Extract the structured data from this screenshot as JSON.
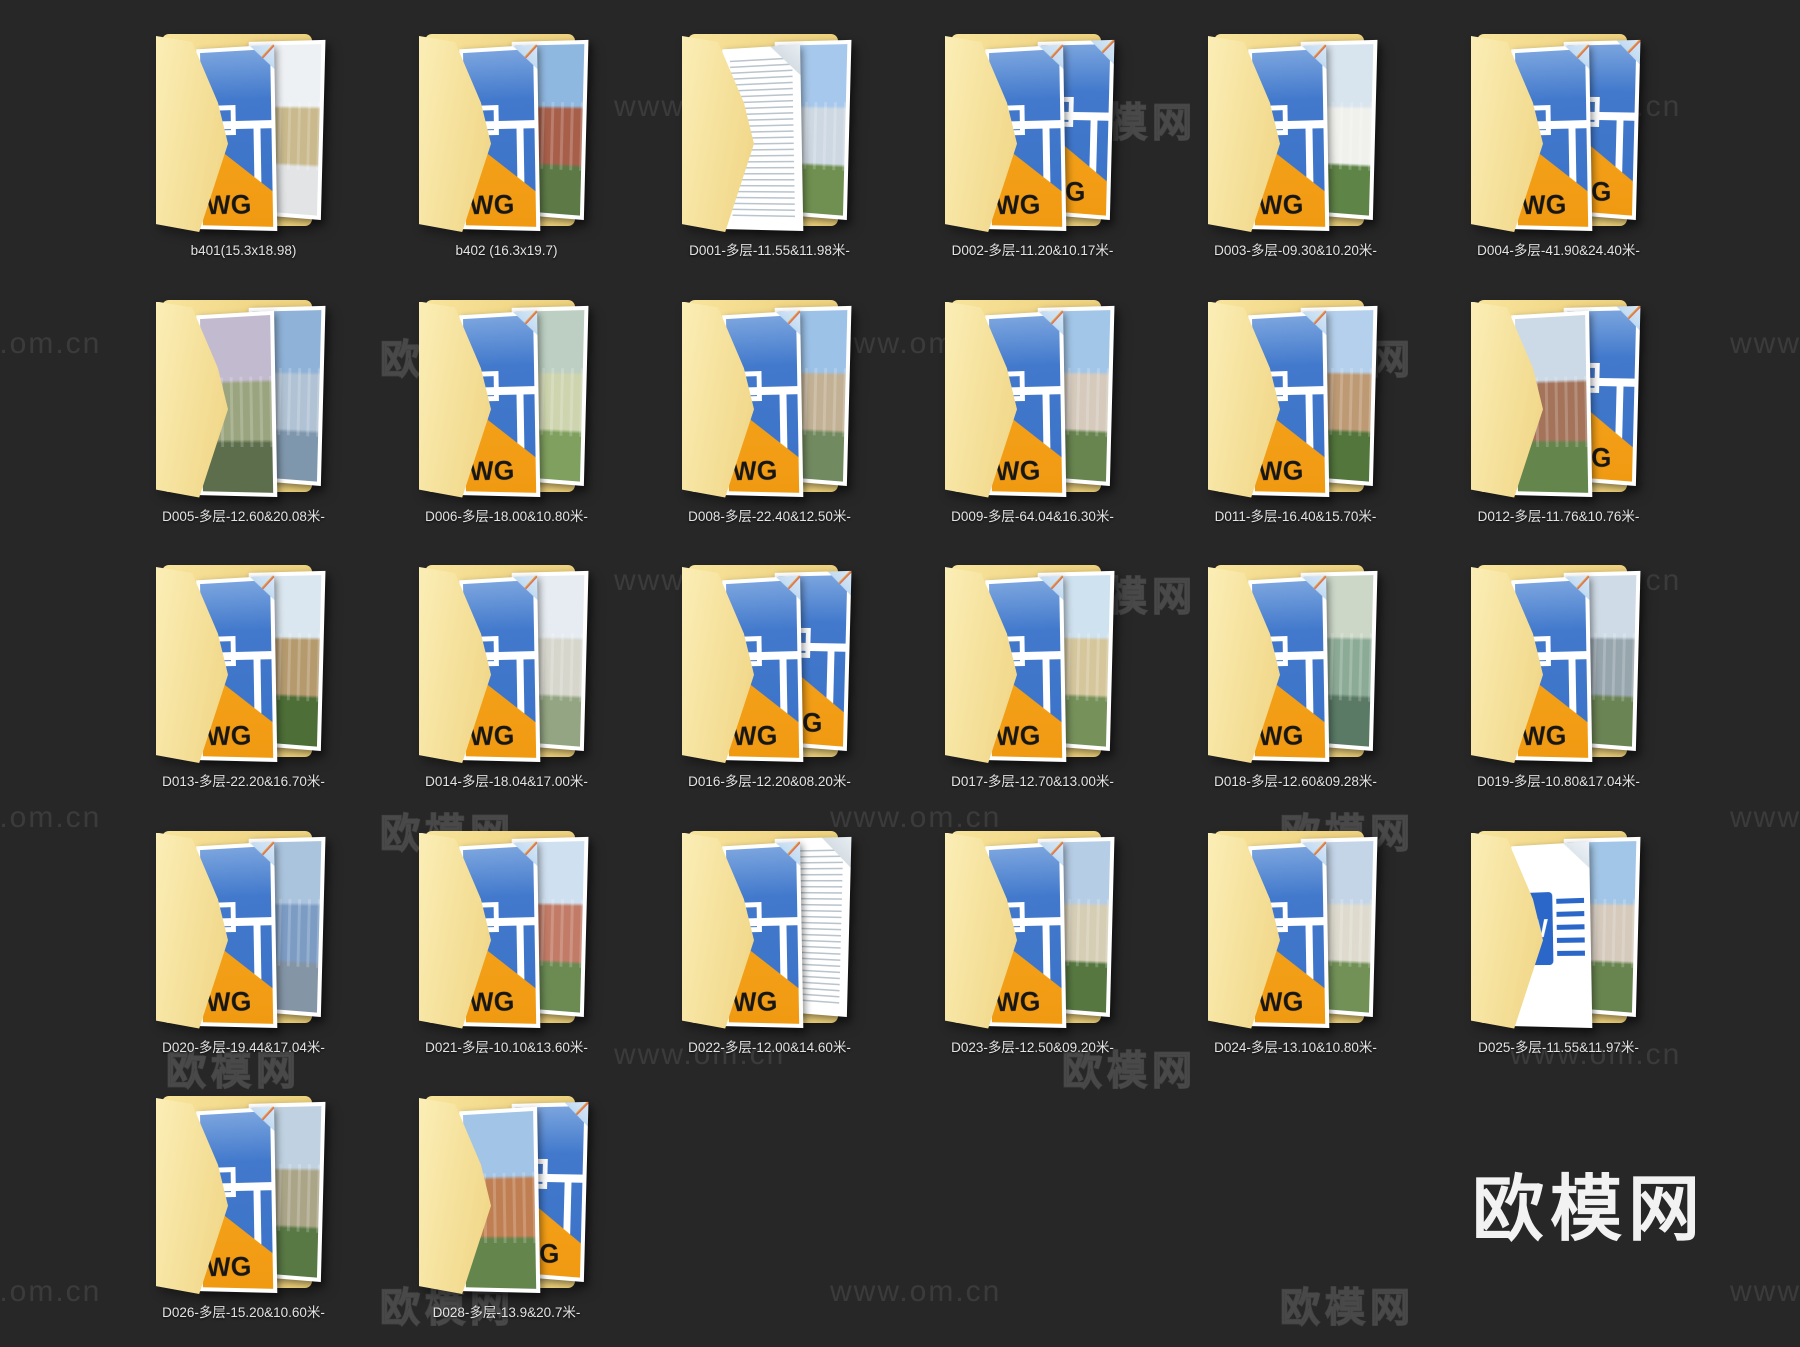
{
  "page": {
    "background": "#272727"
  },
  "watermark": {
    "logo_text": "欧模网",
    "url_text": "www.om.cn"
  },
  "footer_logo": {
    "text": "欧模网"
  },
  "file_type_labels": {
    "dwg_text": "WG",
    "word_letter": "W"
  },
  "accent_colors": {
    "folder_yellow": "#f0d584",
    "dwg_blue": "#3a72c8",
    "dwg_orange": "#f8a81f",
    "word_blue": "#2b67c8",
    "label_text": "#e4e4e4"
  },
  "items": [
    {
      "name": "b401",
      "label": "b401(15.3x18.98)",
      "front": "dwg",
      "back": "photo",
      "back_thumb": {
        "sky": "#eef1f4",
        "mid": "#c9b98c",
        "base": "#e2e4e6"
      }
    },
    {
      "name": "b402",
      "label": "b402 (16.3x19.7)",
      "front": "dwg",
      "back": "photo",
      "back_thumb": {
        "sky": "#8fb8e0",
        "mid": "#a85f4a",
        "base": "#5d7a46"
      }
    },
    {
      "name": "D001",
      "label": "D001-多层-11.55&11.98米-",
      "front": "doc",
      "back": "photo",
      "back_thumb": {
        "sky": "#a6c8ec",
        "mid": "#cdd8e2",
        "base": "#6f9050"
      }
    },
    {
      "name": "D002",
      "label": "D002-多层-11.20&10.17米-",
      "front": "dwg",
      "back": "dwg"
    },
    {
      "name": "D003",
      "label": "D003-多层-09.30&10.20米-",
      "front": "dwg",
      "back": "photo",
      "back_thumb": {
        "sky": "#d8e4ee",
        "mid": "#f0f0ec",
        "base": "#5f8447"
      }
    },
    {
      "name": "D004",
      "label": "D004-多层-41.90&24.40米-",
      "front": "dwg",
      "back": "dwg"
    },
    {
      "name": "D005",
      "label": "D005-多层-12.60&20.08米-",
      "front": "photo",
      "back": "photo",
      "front_thumb": {
        "sky": "#c2bacf",
        "mid": "#9aa47e",
        "base": "#5c6e4c"
      },
      "back_thumb": {
        "sky": "#8fb2d8",
        "mid": "#b0c2d4",
        "base": "#7f97ad"
      }
    },
    {
      "name": "D006",
      "label": "D006-多层-18.00&10.80米-",
      "front": "dwg",
      "back": "photo",
      "back_thumb": {
        "sky": "#bccfc2",
        "mid": "#cdd4ae",
        "base": "#7fa05e"
      }
    },
    {
      "name": "D008",
      "label": "D008-多层-22.40&12.50米-",
      "front": "dwg",
      "back": "photo",
      "back_thumb": {
        "sky": "#9cc2e8",
        "mid": "#c2b194",
        "base": "#728a60"
      }
    },
    {
      "name": "D009",
      "label": "D009-多层-64.04&16.30米-",
      "front": "dwg",
      "back": "photo",
      "back_thumb": {
        "sky": "#a2c6e8",
        "mid": "#d5cabc",
        "base": "#68854f"
      }
    },
    {
      "name": "D011",
      "label": "D011-多层-16.40&15.70米-",
      "front": "dwg",
      "back": "photo",
      "back_thumb": {
        "sky": "#b4d0ec",
        "mid": "#bd9a74",
        "base": "#53763c"
      }
    },
    {
      "name": "D012",
      "label": "D012-多层-11.76&10.76米-",
      "front": "photo",
      "back": "dwg",
      "front_thumb": {
        "sky": "#ccd9e6",
        "mid": "#a4735a",
        "base": "#64854c"
      }
    },
    {
      "name": "D013",
      "label": "D013-多层-22.20&16.70米-",
      "front": "dwg",
      "back": "photo",
      "back_thumb": {
        "sky": "#dbe7f0",
        "mid": "#b59a6e",
        "base": "#4d6e36"
      }
    },
    {
      "name": "D014",
      "label": "D014-多层-18.04&17.00米-",
      "front": "dwg",
      "back": "photo",
      "back_thumb": {
        "sky": "#e6ecf2",
        "mid": "#d6d6cc",
        "base": "#93a582"
      }
    },
    {
      "name": "D016",
      "label": "D016-多层-12.20&08.20米-",
      "front": "dwg",
      "back": "dwg"
    },
    {
      "name": "D017",
      "label": "D017-多层-12.70&13.00米-",
      "front": "dwg",
      "back": "photo",
      "back_thumb": {
        "sky": "#cfe2f0",
        "mid": "#d5c69c",
        "base": "#76915a"
      }
    },
    {
      "name": "D018",
      "label": "D018-多层-12.60&09.28米-",
      "front": "dwg",
      "back": "photo",
      "back_thumb": {
        "sky": "#ccd7c8",
        "mid": "#8cab96",
        "base": "#5a7a66"
      }
    },
    {
      "name": "D019",
      "label": "D019-多层-10.80&17.04米-",
      "front": "dwg",
      "back": "photo",
      "back_thumb": {
        "sky": "#cfdbe6",
        "mid": "#97a5ad",
        "base": "#6b8454"
      }
    },
    {
      "name": "D020",
      "label": "D020-多层-19.44&17.04米-",
      "front": "dwg",
      "back": "photo",
      "back_thumb": {
        "sky": "#aac4de",
        "mid": "#7c9cc4",
        "base": "#8495a6"
      }
    },
    {
      "name": "D021",
      "label": "D021-多层-10.10&13.60米-",
      "front": "dwg",
      "back": "photo",
      "back_thumb": {
        "sky": "#cfe0f0",
        "mid": "#c27b66",
        "base": "#6b8b53"
      }
    },
    {
      "name": "D022",
      "label": "D022-多层-12.00&14.60米-",
      "front": "dwg",
      "back": "doc"
    },
    {
      "name": "D023",
      "label": "D023-多层-12.50&09.20米-",
      "front": "dwg",
      "back": "photo",
      "back_thumb": {
        "sky": "#b6cde6",
        "mid": "#d5cdb4",
        "base": "#567840"
      }
    },
    {
      "name": "D024",
      "label": "D024-多层-13.10&10.80米-",
      "front": "dwg",
      "back": "photo",
      "back_thumb": {
        "sky": "#c4d5e8",
        "mid": "#dedbce",
        "base": "#729157"
      }
    },
    {
      "name": "D025",
      "label": "D025-多层-11.55&11.97米-",
      "front": "word",
      "back": "photo",
      "back_thumb": {
        "sky": "#a2c6e8",
        "mid": "#d5cabc",
        "base": "#68854f"
      }
    },
    {
      "name": "D026",
      "label": "D026-多层-15.20&10.60米-",
      "front": "dwg",
      "back": "photo",
      "back_thumb": {
        "sky": "#c0d2e2",
        "mid": "#aba588",
        "base": "#587844"
      }
    },
    {
      "name": "D028",
      "label": "D028-多层-13.9&20.7米-",
      "front": "photo",
      "back": "dwg",
      "front_thumb": {
        "sky": "#a2c4e6",
        "mid": "#c07f52",
        "base": "#64854c"
      }
    }
  ]
}
